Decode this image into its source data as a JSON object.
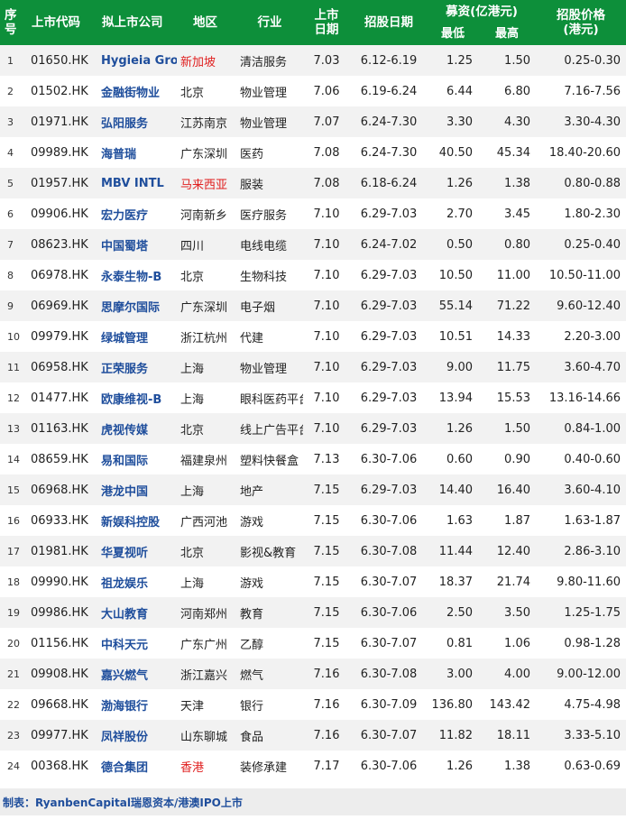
{
  "header": {
    "seq": "序号",
    "code": "上市代码",
    "company": "拟上市公司",
    "region": "地区",
    "industry": "行业",
    "listing_date": "上市日期",
    "offer_period": "招股日期",
    "fundraise": "募资(亿港元)",
    "fund_min": "最低",
    "fund_max": "最高",
    "offer_price": "招股价格(港元)"
  },
  "rows": [
    {
      "seq": "1",
      "code": "01650.HK",
      "company": "Hygieia Gro",
      "region": "新加坡",
      "region_red": true,
      "industry": "清洁服务",
      "date": "7.03",
      "period": "6.12-6.19",
      "min": "1.25",
      "max": "1.50",
      "price": "0.25-0.30"
    },
    {
      "seq": "2",
      "code": "01502.HK",
      "company": "金融街物业",
      "region": "北京",
      "region_red": false,
      "industry": "物业管理",
      "date": "7.06",
      "period": "6.19-6.24",
      "min": "6.44",
      "max": "6.80",
      "price": "7.16-7.56"
    },
    {
      "seq": "3",
      "code": "01971.HK",
      "company": "弘阳服务",
      "region": "江苏南京",
      "region_red": false,
      "industry": "物业管理",
      "date": "7.07",
      "period": "6.24-7.30",
      "min": "3.30",
      "max": "4.30",
      "price": "3.30-4.30"
    },
    {
      "seq": "4",
      "code": "09989.HK",
      "company": "海普瑞",
      "region": "广东深圳",
      "region_red": false,
      "industry": "医药",
      "date": "7.08",
      "period": "6.24-7.30",
      "min": "40.50",
      "max": "45.34",
      "price": "18.40-20.60"
    },
    {
      "seq": "5",
      "code": "01957.HK",
      "company": "MBV INTL",
      "region": "马来西亚",
      "region_red": true,
      "industry": "服装",
      "date": "7.08",
      "period": "6.18-6.24",
      "min": "1.26",
      "max": "1.38",
      "price": "0.80-0.88"
    },
    {
      "seq": "6",
      "code": "09906.HK",
      "company": "宏力医疗",
      "region": "河南新乡",
      "region_red": false,
      "industry": "医疗服务",
      "date": "7.10",
      "period": "6.29-7.03",
      "min": "2.70",
      "max": "3.45",
      "price": "1.80-2.30"
    },
    {
      "seq": "7",
      "code": "08623.HK",
      "company": "中国蜀塔",
      "region": "四川",
      "region_red": false,
      "industry": "电线电缆",
      "date": "7.10",
      "period": "6.24-7.02",
      "min": "0.50",
      "max": "0.80",
      "price": "0.25-0.40"
    },
    {
      "seq": "8",
      "code": "06978.HK",
      "company": "永泰生物-B",
      "region": "北京",
      "region_red": false,
      "industry": "生物科技",
      "date": "7.10",
      "period": "6.29-7.03",
      "min": "10.50",
      "max": "11.00",
      "price": "10.50-11.00"
    },
    {
      "seq": "9",
      "code": "06969.HK",
      "company": "思摩尔国际",
      "region": "广东深圳",
      "region_red": false,
      "industry": "电子烟",
      "date": "7.10",
      "period": "6.29-7.03",
      "min": "55.14",
      "max": "71.22",
      "price": "9.60-12.40"
    },
    {
      "seq": "10",
      "code": "09979.HK",
      "company": "绿城管理",
      "region": "浙江杭州",
      "region_red": false,
      "industry": "代建",
      "date": "7.10",
      "period": "6.29-7.03",
      "min": "10.51",
      "max": "14.33",
      "price": "2.20-3.00"
    },
    {
      "seq": "11",
      "code": "06958.HK",
      "company": "正荣服务",
      "region": "上海",
      "region_red": false,
      "industry": "物业管理",
      "date": "7.10",
      "period": "6.29-7.03",
      "min": "9.00",
      "max": "11.75",
      "price": "3.60-4.70"
    },
    {
      "seq": "12",
      "code": "01477.HK",
      "company": "欧康维视-B",
      "region": "上海",
      "region_red": false,
      "industry": "眼科医药平台",
      "date": "7.10",
      "period": "6.29-7.03",
      "min": "13.94",
      "max": "15.53",
      "price": "13.16-14.66"
    },
    {
      "seq": "13",
      "code": "01163.HK",
      "company": "虎视传媒",
      "region": "北京",
      "region_red": false,
      "industry": "线上广告平台",
      "date": "7.10",
      "period": "6.29-7.03",
      "min": "1.26",
      "max": "1.50",
      "price": "0.84-1.00"
    },
    {
      "seq": "14",
      "code": "08659.HK",
      "company": "易和国际",
      "region": "福建泉州",
      "region_red": false,
      "industry": "塑料快餐盒",
      "date": "7.13",
      "period": "6.30-7.06",
      "min": "0.60",
      "max": "0.90",
      "price": "0.40-0.60"
    },
    {
      "seq": "15",
      "code": "06968.HK",
      "company": "港龙中国",
      "region": "上海",
      "region_red": false,
      "industry": "地产",
      "date": "7.15",
      "period": "6.29-7.03",
      "min": "14.40",
      "max": "16.40",
      "price": "3.60-4.10"
    },
    {
      "seq": "16",
      "code": "06933.HK",
      "company": "新娱科控股",
      "region": "广西河池",
      "region_red": false,
      "industry": "游戏",
      "date": "7.15",
      "period": "6.30-7.06",
      "min": "1.63",
      "max": "1.87",
      "price": "1.63-1.87"
    },
    {
      "seq": "17",
      "code": "01981.HK",
      "company": "华夏视听",
      "region": "北京",
      "region_red": false,
      "industry": "影视&教育",
      "date": "7.15",
      "period": "6.30-7.08",
      "min": "11.44",
      "max": "12.40",
      "price": "2.86-3.10"
    },
    {
      "seq": "18",
      "code": "09990.HK",
      "company": "祖龙娱乐",
      "region": "上海",
      "region_red": false,
      "industry": "游戏",
      "date": "7.15",
      "period": "6.30-7.07",
      "min": "18.37",
      "max": "21.74",
      "price": "9.80-11.60"
    },
    {
      "seq": "19",
      "code": "09986.HK",
      "company": "大山教育",
      "region": "河南郑州",
      "region_red": false,
      "industry": "教育",
      "date": "7.15",
      "period": "6.30-7.06",
      "min": "2.50",
      "max": "3.50",
      "price": "1.25-1.75"
    },
    {
      "seq": "20",
      "code": "01156.HK",
      "company": "中科天元",
      "region": "广东广州",
      "region_red": false,
      "industry": "乙醇",
      "date": "7.15",
      "period": "6.30-7.07",
      "min": "0.81",
      "max": "1.06",
      "price": "0.98-1.28"
    },
    {
      "seq": "21",
      "code": "09908.HK",
      "company": "嘉兴燃气",
      "region": "浙江嘉兴",
      "region_red": false,
      "industry": "燃气",
      "date": "7.16",
      "period": "6.30-7.08",
      "min": "3.00",
      "max": "4.00",
      "price": "9.00-12.00"
    },
    {
      "seq": "22",
      "code": "09668.HK",
      "company": "渤海银行",
      "region": "天津",
      "region_red": false,
      "industry": "银行",
      "date": "7.16",
      "period": "6.30-7.09",
      "min": "136.80",
      "max": "143.42",
      "price": "4.75-4.98"
    },
    {
      "seq": "23",
      "code": "09977.HK",
      "company": "凤祥股份",
      "region": "山东聊城",
      "region_red": false,
      "industry": "食品",
      "date": "7.16",
      "period": "6.30-7.07",
      "min": "11.82",
      "max": "18.11",
      "price": "3.33-5.10"
    },
    {
      "seq": "24",
      "code": "00368.HK",
      "company": "德合集团",
      "region": "香港",
      "region_red": true,
      "industry": "装修承建",
      "date": "7.17",
      "period": "6.30-7.06",
      "min": "1.26",
      "max": "1.38",
      "price": "0.63-0.69"
    }
  ],
  "footer": {
    "credit": "制表：RyanbenCapital瑞恩资本/港澳IPO上市"
  },
  "colors": {
    "header_bg": "#0d8f3a",
    "company_text": "#1f4e9c",
    "region_highlight": "#e02020",
    "row_stripe": "#f2f2f2"
  }
}
